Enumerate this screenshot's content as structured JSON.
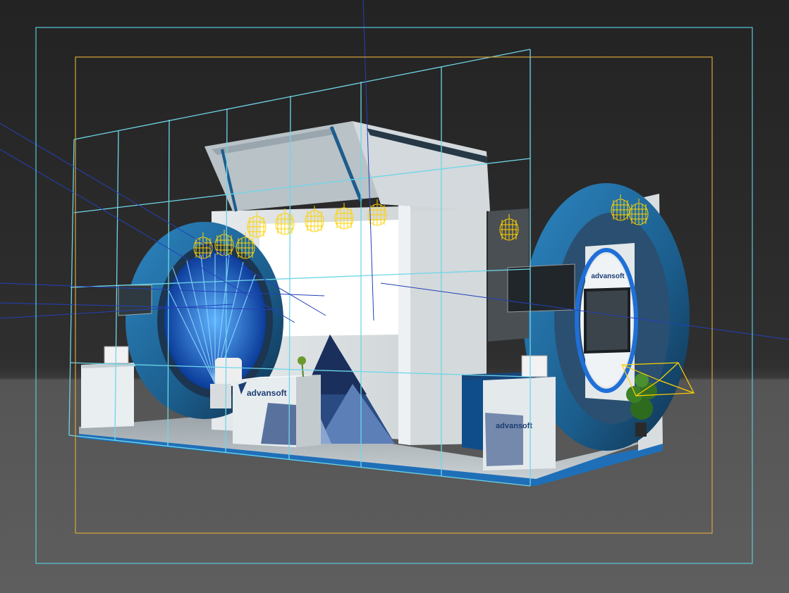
{
  "viewport": {
    "name": "Perspective viewport",
    "colors": {
      "background_top": "#232323",
      "ground": "#5e5e5e",
      "safe_frame_outer": "#58c8d8",
      "safe_frame_inner": "#d6a63a",
      "grid_lines": "#6fd6e8",
      "wireframe_lights": "#ffd200",
      "accent_blue": "#1e6fa8",
      "panel_white": "#e9eef1"
    }
  },
  "scene": {
    "brand": "advansoft",
    "brand_color": "#1f3e73",
    "lamp_icon": "wireframe-pendant-lamp",
    "plant_icon": "potted-plant",
    "camera_icon": "camera-gizmo"
  }
}
